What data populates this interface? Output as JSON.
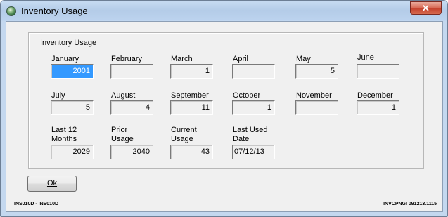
{
  "window": {
    "title": "Inventory Usage",
    "close_glyph": "✕"
  },
  "group": {
    "title": "Inventory Usage"
  },
  "fields": [
    {
      "key": "january",
      "label": "January",
      "value": "2001",
      "selected": true
    },
    {
      "key": "february",
      "label": "February",
      "value": ""
    },
    {
      "key": "march",
      "label": "March",
      "value": "1"
    },
    {
      "key": "april",
      "label": "April",
      "value": ""
    },
    {
      "key": "may",
      "label": "May",
      "value": "5"
    },
    {
      "key": "june",
      "label": "June",
      "value": ""
    },
    {
      "key": "july",
      "label": "July",
      "value": "5"
    },
    {
      "key": "august",
      "label": "August",
      "value": "4"
    },
    {
      "key": "september",
      "label": "September",
      "value": "11"
    },
    {
      "key": "october",
      "label": "October",
      "value": "1"
    },
    {
      "key": "november",
      "label": "November",
      "value": ""
    },
    {
      "key": "december",
      "label": "December",
      "value": "1"
    },
    {
      "key": "last-12-months",
      "label": "Last 12\nMonths",
      "value": "2029"
    },
    {
      "key": "prior-usage",
      "label": "Prior\nUsage",
      "value": "2040"
    },
    {
      "key": "current-usage",
      "label": "Current\nUsage",
      "value": "43"
    },
    {
      "key": "last-used-date",
      "label": "Last Used\nDate",
      "value": "07/12/13"
    }
  ],
  "buttons": {
    "ok_label": "Ok"
  },
  "footer": {
    "left": "INS010D - INS010D",
    "right": "INVCPNGI 091213.1115"
  }
}
